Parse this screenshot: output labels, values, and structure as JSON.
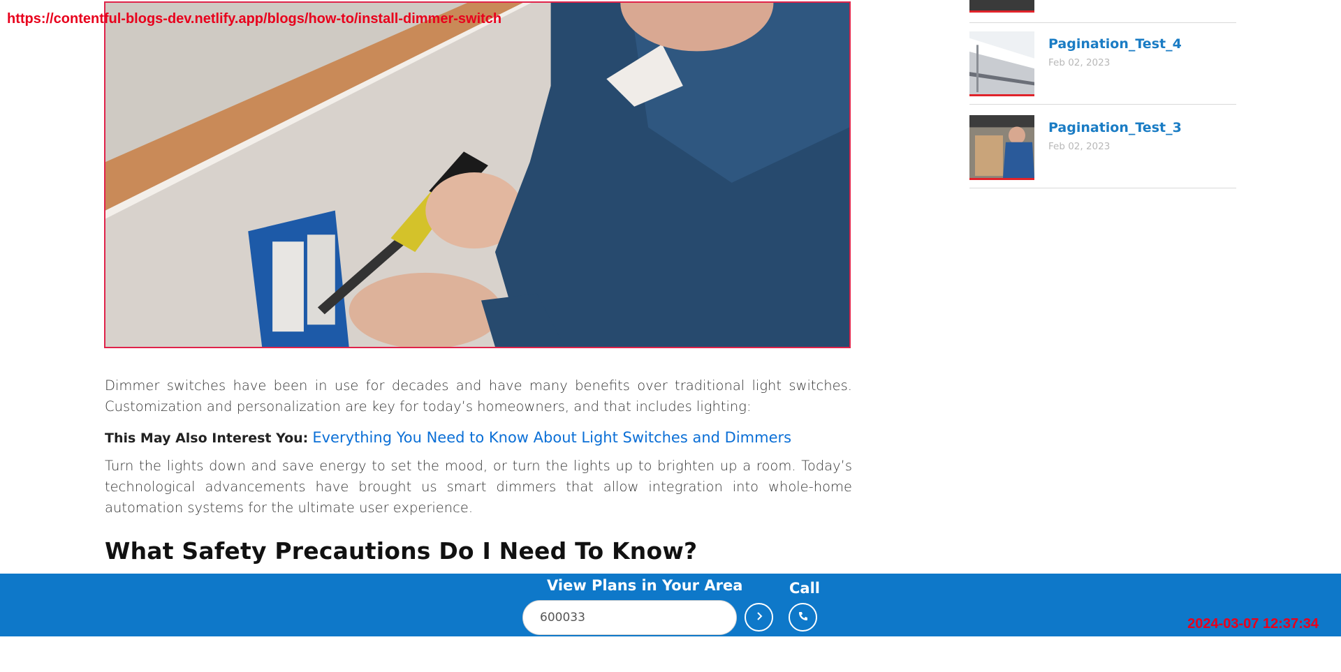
{
  "overlay": {
    "url": "https://contentful-blogs-dev.netlify.app/blogs/how-to/install-dimmer-switch",
    "timestamp": "2024-03-07 12:37:34"
  },
  "article": {
    "paragraph_1": "Dimmer switches have been in use for decades and have many benefits over traditional light switches. Customization and personalization are key for today’s homeowners, and that includes lighting:",
    "interest_label": "This May Also Interest You:",
    "interest_link": "Everything You Need to Know About Light Switches and Dimmers",
    "paragraph_2": "Turn the lights down and save energy to set the mood, or turn the lights up to brighten up a room. Today’s technological advancements have brought us smart dimmers that allow integration into whole-home automation systems for the ultimate user experience.",
    "heading": "What Safety Precautions Do I Need To Know?"
  },
  "sidebar": {
    "items": [
      {
        "title": "Pagination_Test_4",
        "date": "Feb 02, 2023"
      },
      {
        "title": "Pagination_Test_3",
        "date": "Feb 02, 2023"
      }
    ]
  },
  "bottom_bar": {
    "plans_label": "View Plans in Your Area",
    "zip_value": "600033",
    "call_label": "Call"
  },
  "colors": {
    "brand_blue": "#0e78c9",
    "link_blue": "#0b6fd6",
    "accent_red": "#e0234a"
  }
}
